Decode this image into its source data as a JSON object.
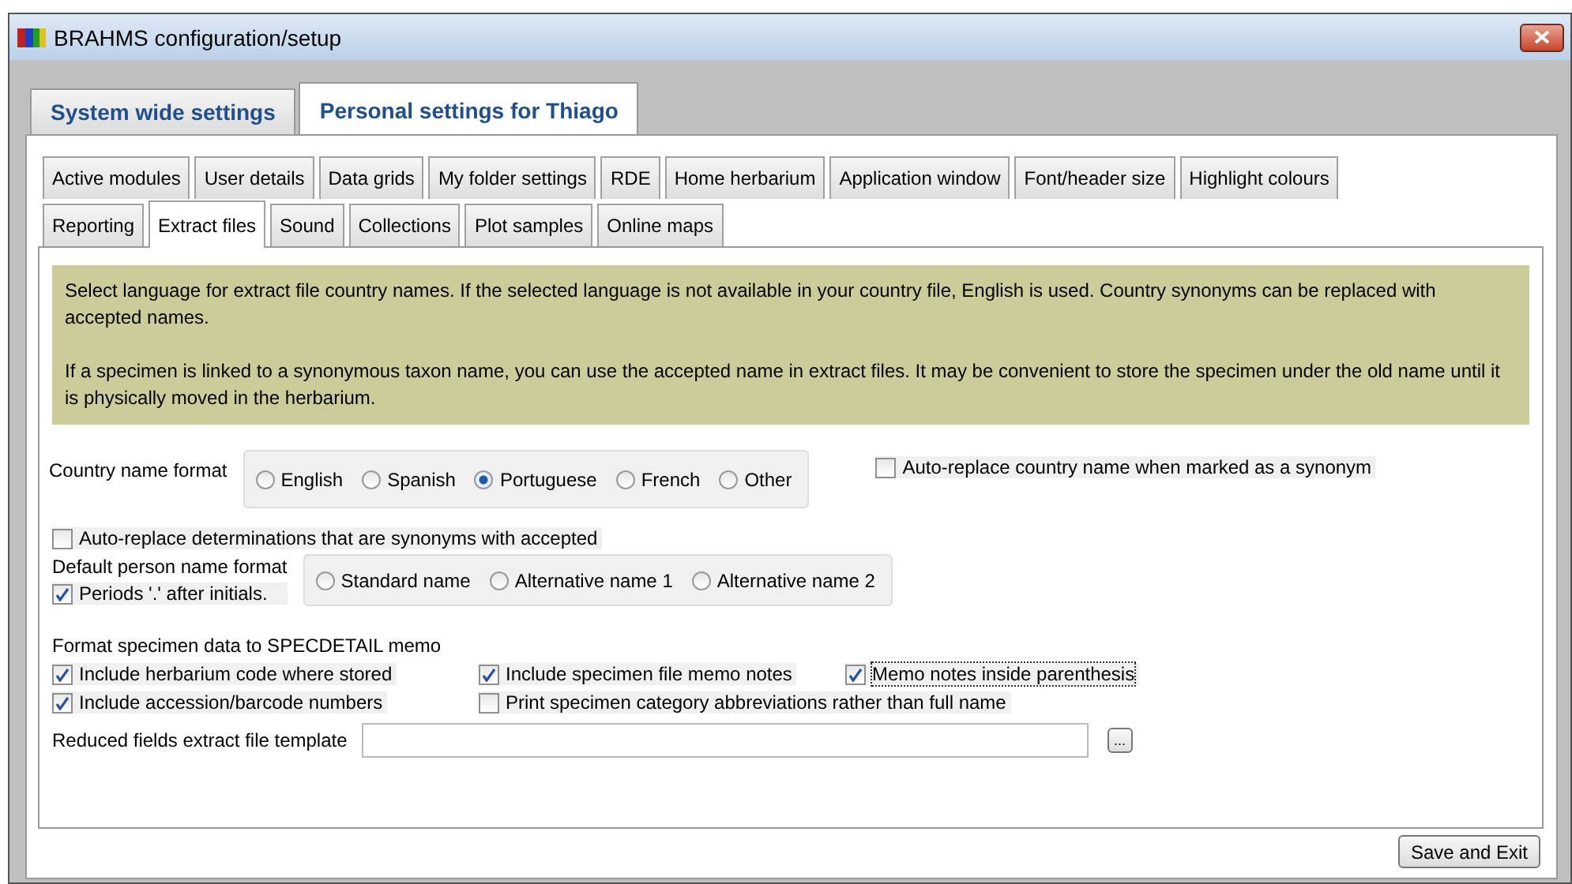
{
  "window": {
    "title": "BRAHMS configuration/setup"
  },
  "outer_tabs": [
    {
      "label": "System wide settings",
      "selected": false
    },
    {
      "label": "Personal settings for Thiago",
      "selected": true
    }
  ],
  "sub_tab_rows": [
    [
      {
        "label": "Active modules",
        "selected": false
      },
      {
        "label": "User details",
        "selected": false
      },
      {
        "label": "Data grids",
        "selected": false
      },
      {
        "label": "My folder settings",
        "selected": false
      },
      {
        "label": "RDE",
        "selected": false
      },
      {
        "label": "Home herbarium",
        "selected": false
      },
      {
        "label": "Application window",
        "selected": false
      },
      {
        "label": "Font/header size",
        "selected": false
      },
      {
        "label": "Highlight colours",
        "selected": false
      }
    ],
    [
      {
        "label": "Reporting",
        "selected": false
      },
      {
        "label": "Extract files",
        "selected": true
      },
      {
        "label": "Sound",
        "selected": false
      },
      {
        "label": "Collections",
        "selected": false
      },
      {
        "label": "Plot samples",
        "selected": false
      },
      {
        "label": "Online maps",
        "selected": false
      }
    ]
  ],
  "info": [
    "Select language for extract file country names. If the selected language is not available in your country file, English is used. Country synonyms can be replaced with accepted names.",
    "If a specimen is linked to a synonymous taxon name, you can use the accepted name in extract files. It may be convenient to store the specimen under the old name until it is physically moved in the herbarium."
  ],
  "country_name_format": {
    "label": "Country name format",
    "options": [
      {
        "label": "English",
        "selected": false
      },
      {
        "label": "Spanish",
        "selected": false
      },
      {
        "label": "Portuguese",
        "selected": true
      },
      {
        "label": "French",
        "selected": false
      },
      {
        "label": "Other",
        "selected": false
      }
    ]
  },
  "auto_replace_country": {
    "label": "Auto-replace country name when marked as a synonym",
    "checked": false
  },
  "auto_replace_determinations": {
    "label": "Auto-replace determinations that are synonyms with accepted",
    "checked": false
  },
  "person_name_format": {
    "label": "Default person name format",
    "periods": {
      "label": "Periods '.' after initials.",
      "checked": true
    },
    "options": [
      {
        "label": "Standard name",
        "selected": false
      },
      {
        "label": "Alternative name 1",
        "selected": false
      },
      {
        "label": "Alternative name 2",
        "selected": false
      }
    ]
  },
  "specdetail": {
    "label": "Format specimen data to SPECDETAIL memo",
    "rows": [
      [
        {
          "label": "Include herbarium code where stored",
          "checked": true,
          "focused": false
        },
        {
          "label": "Include specimen file memo notes",
          "checked": true,
          "focused": false
        },
        {
          "label": "Memo notes inside parenthesis",
          "checked": true,
          "focused": true
        }
      ],
      [
        {
          "label": "Include accession/barcode numbers",
          "checked": true,
          "focused": false
        },
        {
          "label": "Print specimen category abbreviations rather than full name",
          "checked": false,
          "focused": false
        }
      ]
    ]
  },
  "template": {
    "label": "Reduced fields extract file template",
    "browse": "..."
  },
  "save_button": "Save and Exit"
}
